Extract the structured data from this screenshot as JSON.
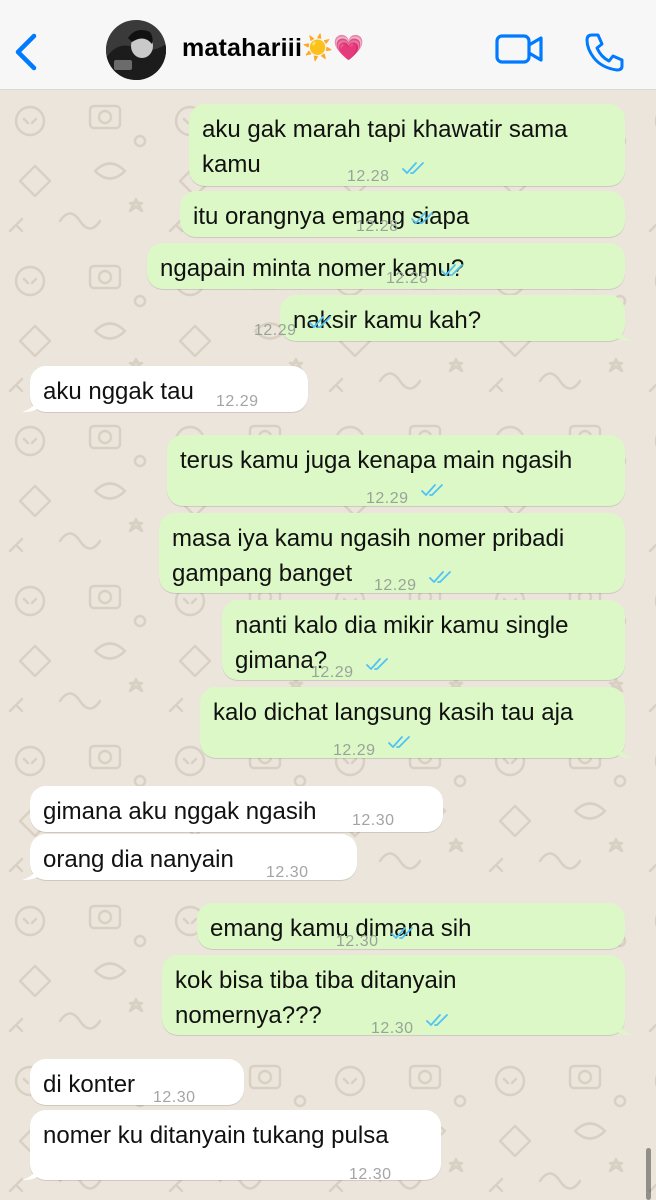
{
  "header": {
    "contact_name": "matahariii☀️💗",
    "back_icon": "chevron-left-icon",
    "video_icon": "video-camera-icon",
    "call_icon": "phone-icon",
    "accent_color": "#007aff"
  },
  "colors": {
    "outgoing_bubble": "#dcf8c6",
    "incoming_bubble": "#ffffff",
    "read_ticks": "#4fc3f7",
    "wallpaper": "#ece5dc"
  },
  "messages": [
    {
      "dir": "out",
      "text": "aku gak marah tapi khawatir sama\nkamu",
      "time": "12.28"
    },
    {
      "dir": "out",
      "text": "itu orangnya emang siapa",
      "time": "12.28"
    },
    {
      "dir": "out",
      "text": "ngapain minta nomer kamu?",
      "time": "12.28"
    },
    {
      "dir": "out",
      "text": "naksir kamu kah?",
      "time": "12.29"
    },
    {
      "dir": "in",
      "text": "aku nggak tau",
      "time": "12.29"
    },
    {
      "dir": "out",
      "text": "terus kamu juga kenapa main ngasih",
      "time": "12.29"
    },
    {
      "dir": "out",
      "text": "masa iya kamu ngasih nomer pribadi\ngampang banget",
      "time": "12.29"
    },
    {
      "dir": "out",
      "text": "nanti kalo dia mikir kamu single\ngimana?",
      "time": "12.29"
    },
    {
      "dir": "out",
      "text": "kalo dichat langsung kasih tau aja",
      "time": "12.29"
    },
    {
      "dir": "in",
      "text": "gimana aku nggak ngasih",
      "time": "12.30"
    },
    {
      "dir": "in",
      "text": "orang dia nanyain",
      "time": "12.30"
    },
    {
      "dir": "out",
      "text": "emang kamu dimana sih",
      "time": "12.30"
    },
    {
      "dir": "out",
      "text": "kok bisa tiba tiba ditanyain\nnomernya???",
      "time": "12.30"
    },
    {
      "dir": "in",
      "text": "di konter",
      "time": "12.30"
    },
    {
      "dir": "in",
      "text": "nomer ku ditanyain tukang pulsa",
      "time": "12.30"
    }
  ]
}
